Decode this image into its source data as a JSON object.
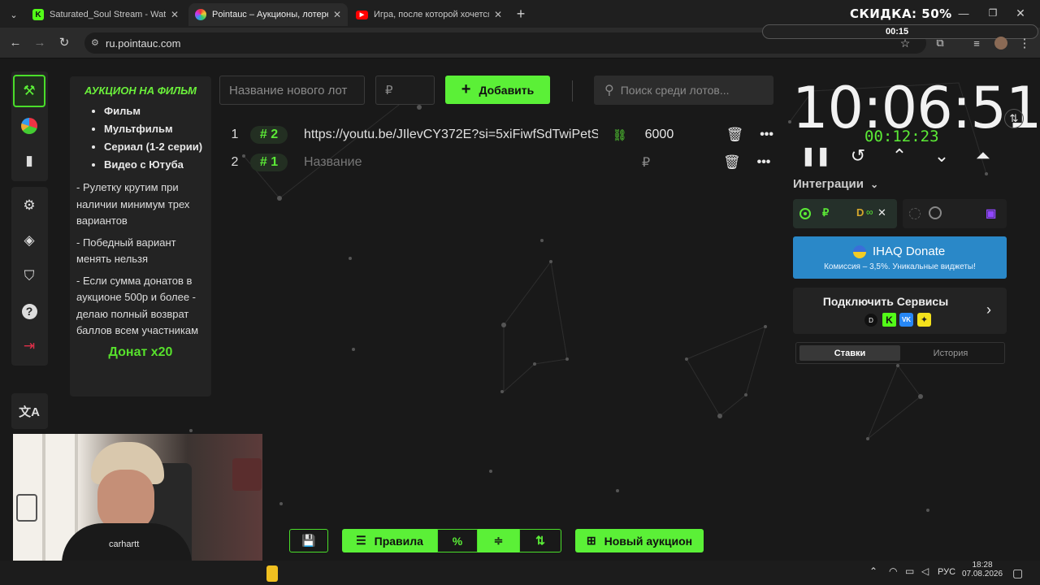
{
  "browser": {
    "tabs": [
      {
        "title": "Saturated_Soul Stream - Watch",
        "icon": "kick-logo",
        "color": "#53fc18"
      },
      {
        "title": "Pointauc – Аукционы, лотереи",
        "icon": "pointauc-logo",
        "color": "#e0a030"
      },
      {
        "title": "Игра, после которой хочется",
        "icon": "youtube-logo",
        "color": "#ff0000"
      }
    ],
    "url": "ru.pointauc.com",
    "promo": "СКИДКА: 50%",
    "progress_time": "00:15"
  },
  "sidebar": {
    "items": [
      "auction",
      "wheel",
      "stats",
      "settings",
      "layers",
      "shield",
      "help",
      "logout",
      "translate"
    ]
  },
  "rules": {
    "title": "АУКЦИОН НА ФИЛЬМ",
    "list": [
      "Фильм",
      "Мультфильм",
      "Сериал (1-2 серии)",
      "Видео с Ютуба"
    ],
    "p1": "- Рулетку крутим при наличии минимум трех вариантов",
    "p2": "- Победный вариант менять нельзя",
    "p3": "-  Если сумма донатов в аукционе 500р и более - делаю полный возврат баллов всем участникам",
    "donat": "Донат х20"
  },
  "controls": {
    "lot_placeholder": "Название нового лот",
    "amount_placeholder": "₽",
    "add_label": "Добавить",
    "search_placeholder": "Поиск среди лотов..."
  },
  "lots": [
    {
      "index": "1",
      "tag": "# 2",
      "name": "https://youtu.be/JIlevCY372E?si=5xiFiwfSdTwiPetS",
      "amount": "6000"
    },
    {
      "index": "2",
      "tag": "# 1",
      "name": "Название",
      "amount": "₽"
    }
  ],
  "right": {
    "clock": "10:06:51",
    "timer": "00:12:23",
    "integrations_label": "Интеграции",
    "donate_title": "IHAQ Donate",
    "donate_sub": "Комиссия – 3,5%. Уникальные виджеты!",
    "connect_label": "Подключить Сервисы",
    "tab_bets": "Ставки",
    "tab_history": "История"
  },
  "bottom": {
    "rules_label": "Правила",
    "new_auction": "Новый аукцион"
  },
  "taskbar": {
    "lang": "РУС",
    "time": "18:28",
    "date": "07.08.2026"
  },
  "webcam": {
    "shirt_text": "carhartt"
  }
}
